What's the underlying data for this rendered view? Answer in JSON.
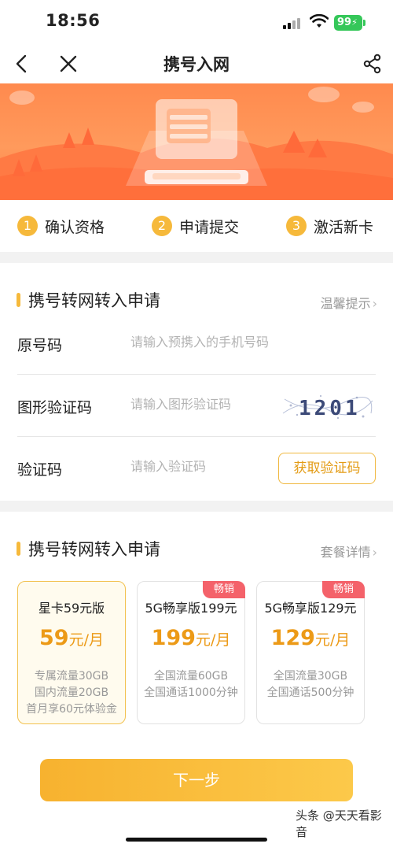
{
  "status_bar": {
    "time": "18:56",
    "battery": "99"
  },
  "nav": {
    "title": "携号入网",
    "back_icon": "chevron-left-icon",
    "close_icon": "close-icon",
    "share_icon": "share-icon"
  },
  "steps": [
    {
      "num": "1",
      "label": "确认资格"
    },
    {
      "num": "2",
      "label": "申请提交"
    },
    {
      "num": "3",
      "label": "激活新卡"
    }
  ],
  "form": {
    "title": "携号转网转入申请",
    "tip_link": "温馨提示",
    "rows": [
      {
        "label": "原号码",
        "placeholder": "请输入预携入的手机号码"
      },
      {
        "label": "图形验证码",
        "placeholder": "请输入图形验证码"
      },
      {
        "label": "验证码",
        "placeholder": "请输入验证码"
      }
    ],
    "get_code_label": "获取验证码",
    "captcha_text": "1201"
  },
  "plans": {
    "title": "携号转网转入申请",
    "detail_link": "套餐详情",
    "items": [
      {
        "name": "星卡59元版",
        "price": "59",
        "unit": "元/月",
        "desc": [
          "专属流量30GB",
          "国内流量20GB",
          "首月享60元体验金"
        ],
        "tag": "",
        "selected": true
      },
      {
        "name": "5G畅享版199元",
        "price": "199",
        "unit": "元/月",
        "desc": [
          "全国流量60GB",
          "全国通话1000分钟"
        ],
        "tag": "畅销",
        "selected": false
      },
      {
        "name": "5G畅享版129元",
        "price": "129",
        "unit": "元/月",
        "desc": [
          "全国流量30GB",
          "全国通话500分钟"
        ],
        "tag": "畅销",
        "selected": false
      }
    ]
  },
  "next_button": "下一步",
  "watermark": "头条 @天天看影音",
  "colors": {
    "accent": "#f6b93b",
    "price": "#ec9a17",
    "banner": "#ff8a4e",
    "tag": "#f4626a"
  }
}
